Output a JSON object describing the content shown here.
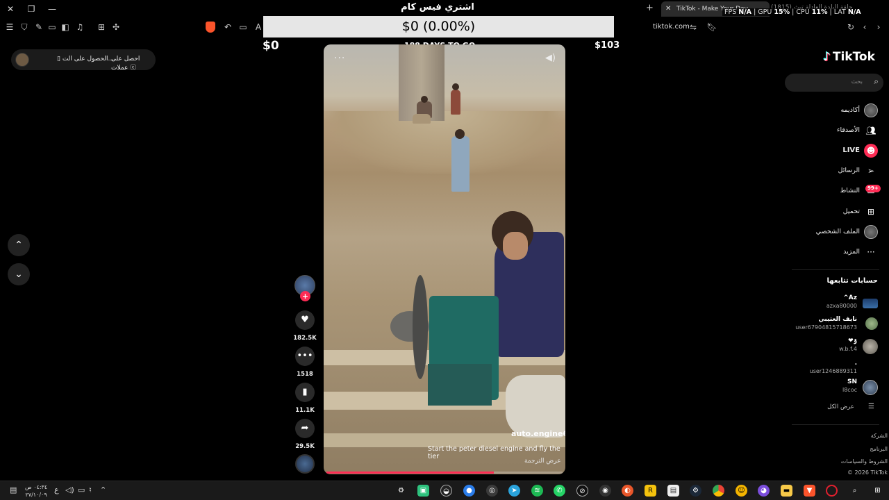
{
  "window": {
    "title": "اشتري فيس كام",
    "tab_title": "TikTok - Make Your Day",
    "background_tab": "(1815) حلقة البلدة العادلة تبث",
    "domain": "tiktok.com"
  },
  "perf": {
    "fps_label": "FPS",
    "fps": "N/A",
    "gpu_label": "GPU",
    "gpu": "15%",
    "cpu_label": "CPU",
    "cpu": "11%",
    "lat_label": "LAT",
    "lat": "N/A"
  },
  "overlay": {
    "bar": "$0 (0.00%)",
    "left": "$0",
    "right": "$103",
    "days": "188 DAYS TO GO"
  },
  "coins": {
    "get_coins": "الحصول على الت...",
    "earn_coins": "احصل على عملات"
  },
  "video": {
    "username": "auto.engine6",
    "caption": "Start the peter diesel engine and fly the tier",
    "translate": "عرض الترجمة",
    "progress": 0.71
  },
  "actions": {
    "likes": "182.5K",
    "comments": "1518",
    "saves": "11.1K",
    "shares": "29.5K"
  },
  "sidebar": {
    "logo": "TikTok",
    "search_placeholder": "بحث",
    "items": [
      {
        "label": "أكاديمه",
        "icon": "avatar-icon"
      },
      {
        "label": "الأصدقاء",
        "icon": "friends-icon"
      },
      {
        "label": "LIVE",
        "icon": "live-icon"
      },
      {
        "label": "الرسائل",
        "icon": "messages-icon"
      },
      {
        "label": "النشاط",
        "icon": "activity-icon"
      },
      {
        "label": "تحميل",
        "icon": "upload-icon"
      },
      {
        "label": "الملف الشخصي",
        "icon": "profile-icon"
      },
      {
        "label": "المزيد",
        "icon": "more-icon"
      }
    ],
    "activity_badge": "99+",
    "following_heading": "حسابات تتابعها",
    "following": [
      {
        "name": "^Az",
        "id": "azxa80000"
      },
      {
        "name": "نايف العتيبي",
        "id": "user67904815718673"
      },
      {
        "name": "❤ۊ",
        "id": "w.b.f.4"
      },
      {
        "name": ".",
        "id": "user1246889311"
      },
      {
        "name": "SN",
        "id": "l8coc"
      }
    ],
    "see_all": "عرض الكل",
    "footer": [
      "الشركة",
      "البرنامج",
      "الشروط والسياسات",
      "© 2026 TikTok"
    ]
  },
  "taskbar": {
    "time": "٠٤:٣٤ ص",
    "date": "٢٧/١٠/٠٩",
    "lang": "ع"
  }
}
